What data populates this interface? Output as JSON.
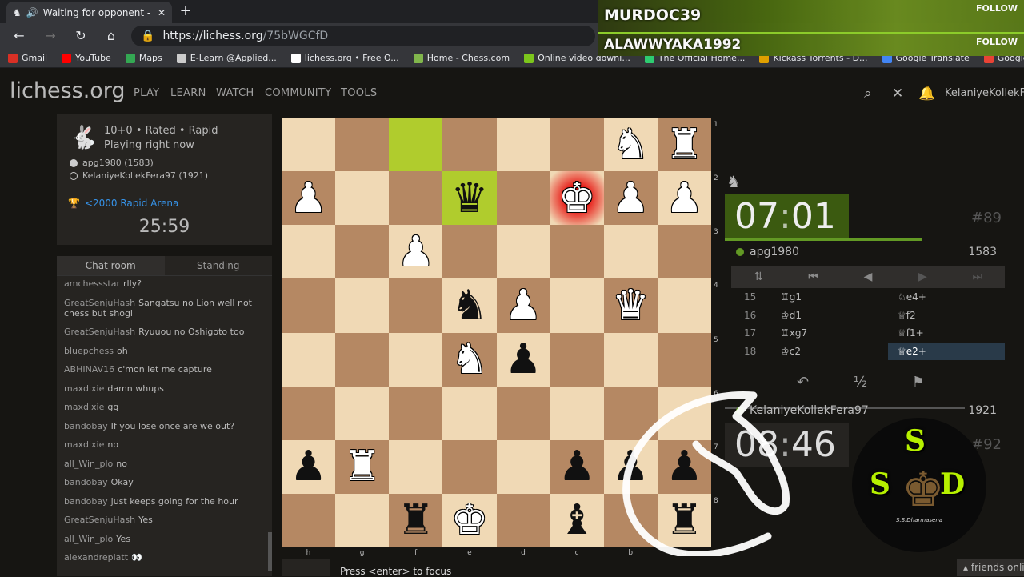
{
  "browser": {
    "tab_title": "Waiting for opponent - Play",
    "url_host": "https://lichess.org",
    "url_path": "/75bWGCfD"
  },
  "bookmarks": [
    {
      "label": "Gmail",
      "color": "#d93025"
    },
    {
      "label": "YouTube",
      "color": "#ff0000"
    },
    {
      "label": "Maps",
      "color": "#34a853"
    },
    {
      "label": "E-Learn @Applied...",
      "color": "#cccccc"
    },
    {
      "label": "lichess.org • Free O...",
      "color": "#ffffff"
    },
    {
      "label": "Home - Chess.com",
      "color": "#81b64c"
    },
    {
      "label": "Online video downl...",
      "color": "#7cc61c"
    },
    {
      "label": "The Official Home...",
      "color": "#2ecc71"
    },
    {
      "label": "Kickass Torrents - D...",
      "color": "#e0a000"
    },
    {
      "label": "Google Translate",
      "color": "#4285f4"
    },
    {
      "label": "Google",
      "color": "#ea4335"
    }
  ],
  "overlay": {
    "name1": "MURDOC39",
    "name2": "ALAWWYAKA1992",
    "follow": "FOLLOW"
  },
  "site": {
    "logo": "lichess.org",
    "menu": [
      "PLAY",
      "LEARN",
      "WATCH",
      "COMMUNITY",
      "TOOLS"
    ],
    "username": "KelaniyeKollekF"
  },
  "game": {
    "line1": "10+0 • Rated • Rapid",
    "line2": "Playing right now",
    "white": "apg1980 (1583)",
    "black": "KelaniyeKollekFera97 (1921)",
    "arena": "<2000 Rapid Arena",
    "arena_clock": "25:59"
  },
  "chat": {
    "tabs": [
      "Chat room",
      "Standing"
    ],
    "messages": [
      {
        "user": "amchessstar",
        "text": "rlly?"
      },
      {
        "user": "GreatSenjuHash",
        "text": "Sangatsu no Lion well not chess but shogi"
      },
      {
        "user": "GreatSenjuHash",
        "text": "Ryuuou no Oshigoto too"
      },
      {
        "user": "bluepchess",
        "text": "oh"
      },
      {
        "user": "ABHINAV16",
        "text": "c'mon let me capture"
      },
      {
        "user": "maxdixie",
        "text": "damn whups"
      },
      {
        "user": "maxdixie",
        "text": "gg"
      },
      {
        "user": "bandobay",
        "text": "If you lose once are we out?"
      },
      {
        "user": "maxdixie",
        "text": "no"
      },
      {
        "user": "all_Win_plo",
        "text": "no"
      },
      {
        "user": "bandobay",
        "text": "Okay"
      },
      {
        "user": "bandobay",
        "text": "just keeps going for the hour"
      },
      {
        "user": "GreatSenjuHash",
        "text": "Yes"
      },
      {
        "user": "all_Win_plo",
        "text": "Yes"
      },
      {
        "user": "alexandreplatt",
        "text": "👀"
      }
    ]
  },
  "board": {
    "files": [
      "h",
      "g",
      "f",
      "e",
      "d",
      "c",
      "b",
      "a"
    ],
    "ranks": [
      "1",
      "2",
      "3",
      "4",
      "5",
      "6",
      "7",
      "8"
    ],
    "pieces": [
      {
        "c": 6,
        "r": 0,
        "g": "♞",
        "s": "w"
      },
      {
        "c": 7,
        "r": 0,
        "g": "♜",
        "s": "w"
      },
      {
        "c": 0,
        "r": 1,
        "g": "♟",
        "s": "w"
      },
      {
        "c": 3,
        "r": 1,
        "g": "♛",
        "s": "b"
      },
      {
        "c": 5,
        "r": 1,
        "g": "♚",
        "s": "w"
      },
      {
        "c": 6,
        "r": 1,
        "g": "♟",
        "s": "w"
      },
      {
        "c": 7,
        "r": 1,
        "g": "♟",
        "s": "w"
      },
      {
        "c": 2,
        "r": 2,
        "g": "♟",
        "s": "w"
      },
      {
        "c": 3,
        "r": 3,
        "g": "♞",
        "s": "b"
      },
      {
        "c": 4,
        "r": 3,
        "g": "♟",
        "s": "w"
      },
      {
        "c": 6,
        "r": 3,
        "g": "♛",
        "s": "w"
      },
      {
        "c": 3,
        "r": 4,
        "g": "♞",
        "s": "w"
      },
      {
        "c": 4,
        "r": 4,
        "g": "♟",
        "s": "b"
      },
      {
        "c": 0,
        "r": 6,
        "g": "♟",
        "s": "b"
      },
      {
        "c": 1,
        "r": 6,
        "g": "♜",
        "s": "w"
      },
      {
        "c": 5,
        "r": 6,
        "g": "♟",
        "s": "b"
      },
      {
        "c": 6,
        "r": 6,
        "g": "♟",
        "s": "b"
      },
      {
        "c": 7,
        "r": 6,
        "g": "♟",
        "s": "b"
      },
      {
        "c": 2,
        "r": 7,
        "g": "♜",
        "s": "b"
      },
      {
        "c": 3,
        "r": 7,
        "g": "♚",
        "s": "w"
      },
      {
        "c": 5,
        "r": 7,
        "g": "♝",
        "s": "b"
      },
      {
        "c": 7,
        "r": 7,
        "g": "♜",
        "s": "b"
      }
    ],
    "highlights": [
      {
        "c": 2,
        "r": 0
      },
      {
        "c": 3,
        "r": 1
      }
    ],
    "check": {
      "c": 5,
      "r": 1
    }
  },
  "clocks": {
    "top_time_m": "07",
    "top_time_s": "01",
    "top_count": "#89",
    "top_player": "apg1980",
    "top_rating": "1583",
    "bottom_time_m": "08",
    "bottom_time_s": "46",
    "bottom_count": "#92",
    "bottom_player": "KelaniyeKollekFera97",
    "bottom_rating": "1921"
  },
  "moves": [
    {
      "n": "15",
      "w": "♖g1",
      "b": "♘e4+"
    },
    {
      "n": "16",
      "w": "♔d1",
      "b": "♕f2"
    },
    {
      "n": "17",
      "w": "♖xg7",
      "b": "♕f1+"
    },
    {
      "n": "18",
      "w": "♔c2",
      "b": "♕e2+"
    }
  ],
  "footer": {
    "hint": "Press <enter> to focus",
    "friends": "friends online"
  },
  "brand": {
    "l1": "S",
    "l2": "S",
    "l3": "D",
    "sub": "S.S.Dharmasena"
  }
}
